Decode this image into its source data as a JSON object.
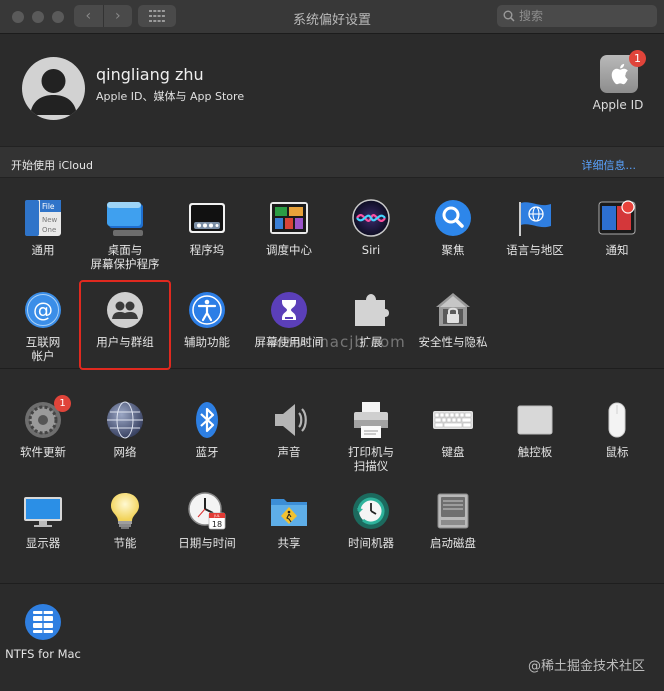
{
  "window": {
    "title": "系统偏好设置",
    "search_placeholder": "搜索",
    "nav_back": "‹",
    "nav_forward": "›"
  },
  "account": {
    "name": "qingliang zhu",
    "subtitle": "Apple ID、媒体与 App Store",
    "appleid_label": "Apple ID",
    "appleid_badge": "1"
  },
  "icloud": {
    "text": "开始使用 iCloud",
    "link": "详细信息..."
  },
  "row1": [
    {
      "label": "通用",
      "icon": "general-icon"
    },
    {
      "label": "桌面与\n屏幕保护程序",
      "icon": "desktop-screensaver-icon"
    },
    {
      "label": "程序坞",
      "icon": "dock-icon"
    },
    {
      "label": "调度中心",
      "icon": "mission-control-icon"
    },
    {
      "label": "Siri",
      "icon": "siri-icon"
    },
    {
      "label": "聚焦",
      "icon": "spotlight-icon"
    },
    {
      "label": "语言与地区",
      "icon": "language-region-icon"
    },
    {
      "label": "通知",
      "icon": "notifications-icon"
    }
  ],
  "row2": [
    {
      "label": "互联网\n帐户",
      "icon": "internet-accounts-icon"
    },
    {
      "label": "用户与群组",
      "icon": "users-groups-icon"
    },
    {
      "label": "辅助功能",
      "icon": "accessibility-icon"
    },
    {
      "label": "屏幕使用时间",
      "icon": "screen-time-icon"
    },
    {
      "label": "扩展",
      "icon": "extensions-icon"
    },
    {
      "label": "安全性与隐私",
      "icon": "security-privacy-icon"
    }
  ],
  "row3": [
    {
      "label": "软件更新",
      "icon": "software-update-icon",
      "badge": "1"
    },
    {
      "label": "网络",
      "icon": "network-icon"
    },
    {
      "label": "蓝牙",
      "icon": "bluetooth-icon"
    },
    {
      "label": "声音",
      "icon": "sound-icon"
    },
    {
      "label": "打印机与\n扫描仪",
      "icon": "printers-scanners-icon"
    },
    {
      "label": "键盘",
      "icon": "keyboard-icon"
    },
    {
      "label": "触控板",
      "icon": "trackpad-icon"
    },
    {
      "label": "鼠标",
      "icon": "mouse-icon"
    }
  ],
  "row4": [
    {
      "label": "显示器",
      "icon": "displays-icon"
    },
    {
      "label": "节能",
      "icon": "energy-saver-icon"
    },
    {
      "label": "日期与时间",
      "icon": "date-time-icon"
    },
    {
      "label": "共享",
      "icon": "sharing-icon"
    },
    {
      "label": "时间机器",
      "icon": "time-machine-icon"
    },
    {
      "label": "启动磁盘",
      "icon": "startup-disk-icon"
    }
  ],
  "row5": [
    {
      "label": "NTFS for Mac",
      "icon": "ntfs-for-mac-icon"
    }
  ],
  "watermark": "www.macjb.com",
  "footer_watermark": "@稀土掘金技术社区",
  "icon_text": {
    "general_file": "File",
    "general_new": "New",
    "general_one": "One",
    "calendar_month": "JUL",
    "calendar_day": "18"
  },
  "colors": {
    "background": "#2b2b2b",
    "highlight": "#e0291f",
    "badge": "#e0443a",
    "link": "#5aa3ff"
  }
}
